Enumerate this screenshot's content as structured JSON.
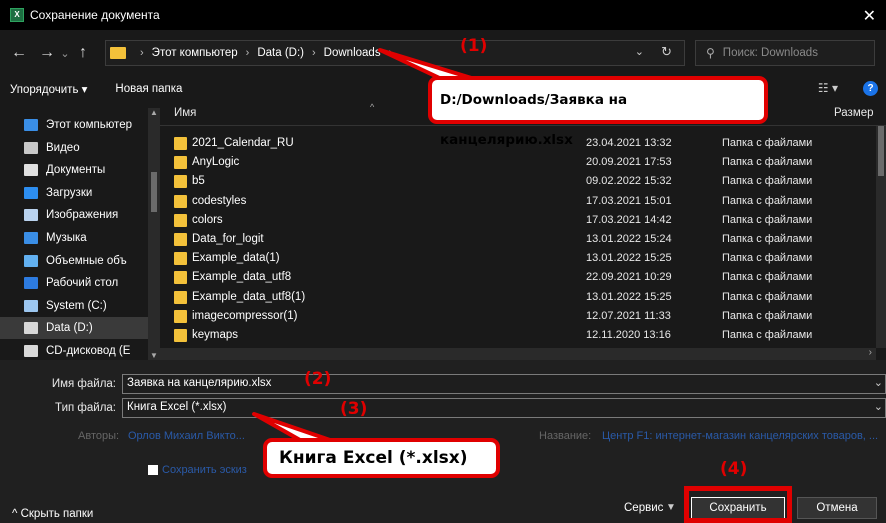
{
  "window": {
    "title": "Сохранение документа",
    "app_icon_text": "X",
    "close_glyph": "✕"
  },
  "nav": {
    "back": "←",
    "forward": "→",
    "recent": "⌄",
    "up": "↑"
  },
  "address": {
    "crumbs": [
      "Этот компьютер",
      "Data (D:)",
      "Downloads"
    ],
    "separator": "›",
    "dropdown": "⌄",
    "refresh": "↻"
  },
  "search": {
    "placeholder": "Поиск: Downloads",
    "icon": "⚲"
  },
  "toolbar": {
    "organize": "Упорядочить ▾",
    "new_folder": "Новая папка",
    "view_icon": "☷ ▾",
    "help": "?"
  },
  "sidebar": {
    "items": [
      {
        "label": "Этот компьютер",
        "color": "#3a8ee6"
      },
      {
        "label": "Видео",
        "color": "#c8c8c8"
      },
      {
        "label": "Документы",
        "color": "#e0e0e0"
      },
      {
        "label": "Загрузки",
        "color": "#2d8ef0"
      },
      {
        "label": "Изображения",
        "color": "#b9d2ee"
      },
      {
        "label": "Музыка",
        "color": "#3a8ee6"
      },
      {
        "label": "Объемные объ",
        "color": "#62b0f0"
      },
      {
        "label": "Рабочий стол",
        "color": "#2d7be0"
      },
      {
        "label": "System (C:)",
        "color": "#9cc6ef"
      },
      {
        "label": "Data (D:)",
        "color": "#d8d8d8"
      },
      {
        "label": "CD-дисковод (E",
        "color": "#d8d8d8"
      }
    ],
    "selected_index": 9
  },
  "columns": {
    "name": "Имя",
    "date": "",
    "type": "",
    "size": "Размер"
  },
  "files": [
    {
      "name": "2021_Calendar_RU",
      "date": "23.04.2021 13:32",
      "type": "Папка с файлами"
    },
    {
      "name": "AnyLogic",
      "date": "20.09.2021 17:53",
      "type": "Папка с файлами"
    },
    {
      "name": "b5",
      "date": "09.02.2022 15:32",
      "type": "Папка с файлами"
    },
    {
      "name": "codestyles",
      "date": "17.03.2021 15:01",
      "type": "Папка с файлами"
    },
    {
      "name": "colors",
      "date": "17.03.2021 14:42",
      "type": "Папка с файлами"
    },
    {
      "name": "Data_for_logit",
      "date": "13.01.2022 15:24",
      "type": "Папка с файлами"
    },
    {
      "name": "Example_data(1)",
      "date": "13.01.2022 15:25",
      "type": "Папка с файлами"
    },
    {
      "name": "Example_data_utf8",
      "date": "22.09.2021 10:29",
      "type": "Папка с файлами"
    },
    {
      "name": "Example_data_utf8(1)",
      "date": "13.01.2022 15:25",
      "type": "Папка с файлами"
    },
    {
      "name": "imagecompressor(1)",
      "date": "12.07.2021 11:33",
      "type": "Папка с файлами"
    },
    {
      "name": "keymaps",
      "date": "12.11.2020 13:16",
      "type": "Папка с файлами"
    }
  ],
  "form": {
    "filename_label": "Имя файла:",
    "filename_value": "Заявка на канцелярию.xlsx",
    "filetype_label": "Тип файла:",
    "filetype_value": "Книга Excel (*.xlsx)",
    "authors_label": "Авторы:",
    "authors_value": "Орлов Михаил Викто...",
    "title_label": "Название:",
    "title_value": "Центр F1: интернет-магазин канцелярских товаров, ...",
    "save_thumbnail": "Сохранить эскиз",
    "dropdown": "⌄"
  },
  "footer": {
    "hide_folders": "^  Скрыть папки",
    "service": "Сервис",
    "service_dd": "▼",
    "save": "Сохранить",
    "cancel": "Отмена"
  },
  "annotations": {
    "n1": "(1)",
    "n2": "(2)",
    "n3": "(3)",
    "n4": "(4)",
    "path_callout": "D:/Downloads/Заявка на канцелярию.xlsx",
    "type_callout": "Книга Excel (*.xlsx)",
    "color": "#e00000"
  }
}
